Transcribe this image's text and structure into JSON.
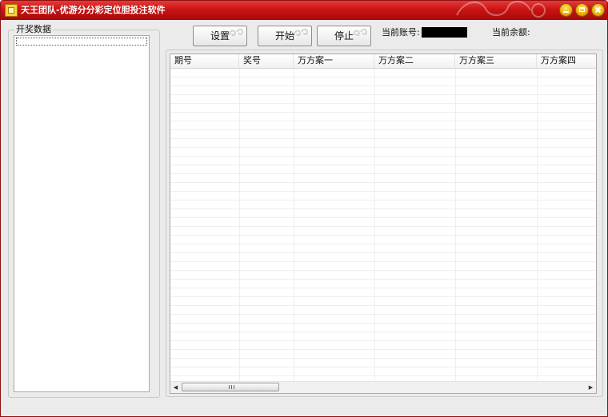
{
  "window": {
    "title": "天王团队-优游分分彩定位胆投注软件",
    "accent": "#c91414",
    "controls": [
      "minimize-icon",
      "maximize-icon",
      "close-icon"
    ]
  },
  "left_panel": {
    "group_label": "开奖数据",
    "items": []
  },
  "toolbar": {
    "settings_label": "设置",
    "start_label": "开始",
    "stop_label": "停止"
  },
  "account": {
    "account_label": "当前账号:",
    "balance_label": "当前余额:"
  },
  "grid": {
    "columns": [
      "期号",
      "奖号",
      "万方案一",
      "万方案二",
      "万方案三",
      "万方案四"
    ],
    "rows": [],
    "hscroll_position": 0.0
  }
}
